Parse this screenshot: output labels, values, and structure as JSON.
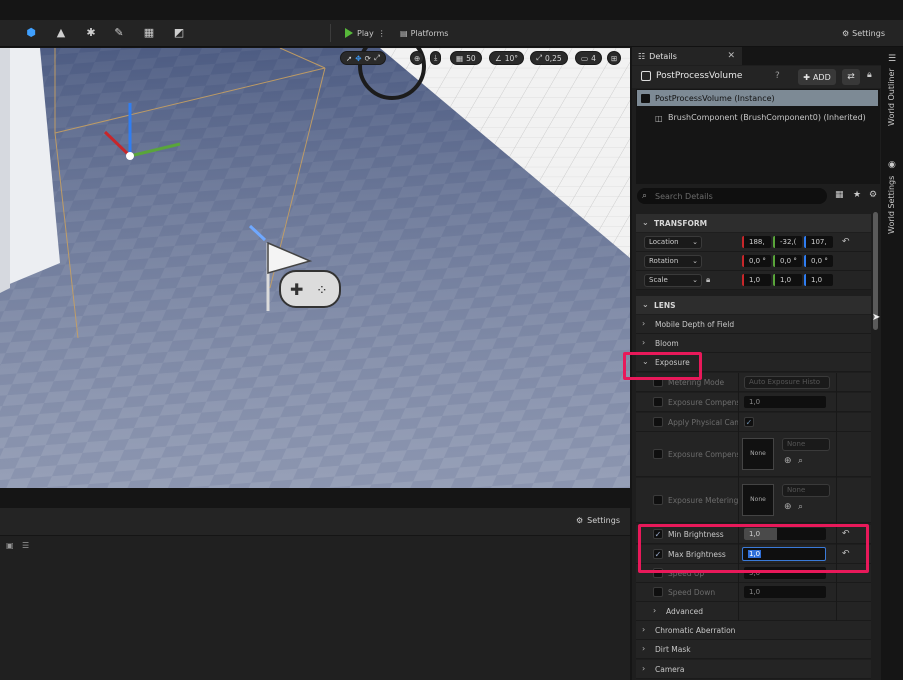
{
  "toolbar": {
    "play_label": "Play",
    "platforms_label": "Platforms",
    "settings_label": "Settings"
  },
  "viewport": {
    "grid_snap": "50",
    "rotation_snap": "10°",
    "scale_snap": "0,25",
    "camera_speed": "4"
  },
  "lower_panel": {
    "settings_label": "Settings"
  },
  "details": {
    "tab_label": "Details",
    "actor_name": "PostProcessVolume",
    "add_label": "ADD",
    "components": {
      "selected": "PostProcessVolume (Instance)",
      "child": "BrushComponent (BrushComponent0) (Inherited)"
    },
    "search_placeholder": "Search Details",
    "transform": {
      "header": "TRANSFORM",
      "location": {
        "label": "Location",
        "x": "188,",
        "y": "-32,(",
        "z": "107,"
      },
      "rotation": {
        "label": "Rotation",
        "x": "0,0 °",
        "y": "0,0 °",
        "z": "0,0 °"
      },
      "scale": {
        "label": "Scale",
        "x": "1,0",
        "y": "1,0",
        "z": "1,0"
      }
    },
    "lens": {
      "header": "LENS",
      "mobile_dof": "Mobile Depth of Field",
      "bloom": "Bloom",
      "exposure": "Exposure",
      "metering_mode": {
        "label": "Metering Mode",
        "value": "Auto Exposure Histo"
      },
      "exposure_comp": {
        "label": "Exposure Compensa",
        "value": "1,0"
      },
      "apply_physical": {
        "label": "Apply Physical Cam"
      },
      "exposure_comp_curve": {
        "label": "Exposure Compensa",
        "thumb": "None",
        "dropdown": "None"
      },
      "exposure_metering": {
        "label": "Exposure Metering",
        "thumb": "None",
        "dropdown": "None"
      },
      "min_brightness": {
        "label": "Min Brightness",
        "value": "1,0",
        "fill": 0.4
      },
      "max_brightness": {
        "label": "Max Brightness",
        "value": "1,0"
      },
      "speed_up": {
        "label": "Speed Up",
        "value": "3,0"
      },
      "speed_down": {
        "label": "Speed Down",
        "value": "1,0"
      },
      "advanced": "Advanced"
    },
    "more_sections": {
      "chromatic": "Chromatic Aberration",
      "dirt_mask": "Dirt Mask",
      "camera": "Camera"
    }
  },
  "side_tabs": {
    "world_outliner": "World Outliner",
    "world_settings": "World Settings"
  },
  "colors": {
    "highlight": "#e8195a",
    "play_green": "#57b83a",
    "selection": "#7d8a95"
  }
}
